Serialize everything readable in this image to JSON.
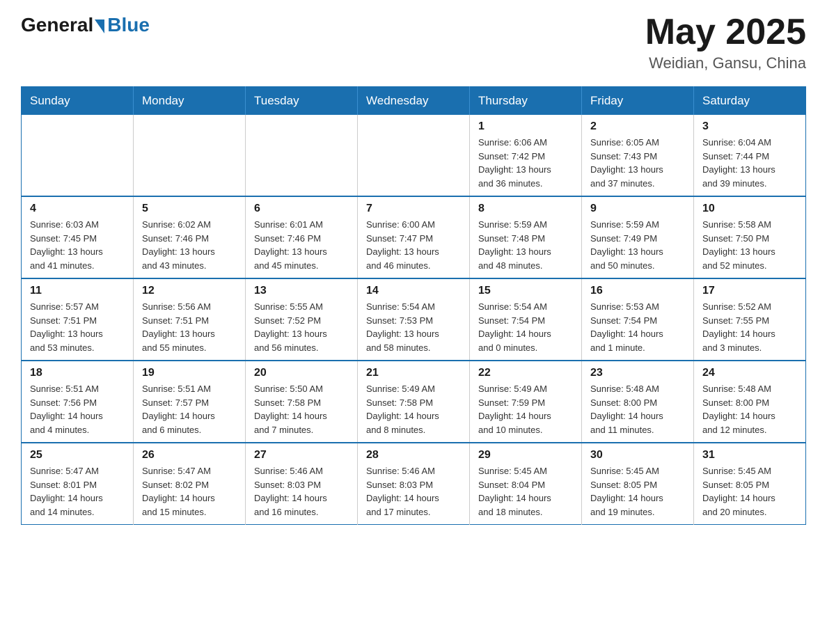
{
  "header": {
    "logo_general": "General",
    "logo_blue": "Blue",
    "title": "May 2025",
    "location": "Weidian, Gansu, China"
  },
  "days_of_week": [
    "Sunday",
    "Monday",
    "Tuesday",
    "Wednesday",
    "Thursday",
    "Friday",
    "Saturday"
  ],
  "weeks": [
    {
      "cells": [
        {
          "day": "",
          "info": ""
        },
        {
          "day": "",
          "info": ""
        },
        {
          "day": "",
          "info": ""
        },
        {
          "day": "",
          "info": ""
        },
        {
          "day": "1",
          "info": "Sunrise: 6:06 AM\nSunset: 7:42 PM\nDaylight: 13 hours\nand 36 minutes."
        },
        {
          "day": "2",
          "info": "Sunrise: 6:05 AM\nSunset: 7:43 PM\nDaylight: 13 hours\nand 37 minutes."
        },
        {
          "day": "3",
          "info": "Sunrise: 6:04 AM\nSunset: 7:44 PM\nDaylight: 13 hours\nand 39 minutes."
        }
      ]
    },
    {
      "cells": [
        {
          "day": "4",
          "info": "Sunrise: 6:03 AM\nSunset: 7:45 PM\nDaylight: 13 hours\nand 41 minutes."
        },
        {
          "day": "5",
          "info": "Sunrise: 6:02 AM\nSunset: 7:46 PM\nDaylight: 13 hours\nand 43 minutes."
        },
        {
          "day": "6",
          "info": "Sunrise: 6:01 AM\nSunset: 7:46 PM\nDaylight: 13 hours\nand 45 minutes."
        },
        {
          "day": "7",
          "info": "Sunrise: 6:00 AM\nSunset: 7:47 PM\nDaylight: 13 hours\nand 46 minutes."
        },
        {
          "day": "8",
          "info": "Sunrise: 5:59 AM\nSunset: 7:48 PM\nDaylight: 13 hours\nand 48 minutes."
        },
        {
          "day": "9",
          "info": "Sunrise: 5:59 AM\nSunset: 7:49 PM\nDaylight: 13 hours\nand 50 minutes."
        },
        {
          "day": "10",
          "info": "Sunrise: 5:58 AM\nSunset: 7:50 PM\nDaylight: 13 hours\nand 52 minutes."
        }
      ]
    },
    {
      "cells": [
        {
          "day": "11",
          "info": "Sunrise: 5:57 AM\nSunset: 7:51 PM\nDaylight: 13 hours\nand 53 minutes."
        },
        {
          "day": "12",
          "info": "Sunrise: 5:56 AM\nSunset: 7:51 PM\nDaylight: 13 hours\nand 55 minutes."
        },
        {
          "day": "13",
          "info": "Sunrise: 5:55 AM\nSunset: 7:52 PM\nDaylight: 13 hours\nand 56 minutes."
        },
        {
          "day": "14",
          "info": "Sunrise: 5:54 AM\nSunset: 7:53 PM\nDaylight: 13 hours\nand 58 minutes."
        },
        {
          "day": "15",
          "info": "Sunrise: 5:54 AM\nSunset: 7:54 PM\nDaylight: 14 hours\nand 0 minutes."
        },
        {
          "day": "16",
          "info": "Sunrise: 5:53 AM\nSunset: 7:54 PM\nDaylight: 14 hours\nand 1 minute."
        },
        {
          "day": "17",
          "info": "Sunrise: 5:52 AM\nSunset: 7:55 PM\nDaylight: 14 hours\nand 3 minutes."
        }
      ]
    },
    {
      "cells": [
        {
          "day": "18",
          "info": "Sunrise: 5:51 AM\nSunset: 7:56 PM\nDaylight: 14 hours\nand 4 minutes."
        },
        {
          "day": "19",
          "info": "Sunrise: 5:51 AM\nSunset: 7:57 PM\nDaylight: 14 hours\nand 6 minutes."
        },
        {
          "day": "20",
          "info": "Sunrise: 5:50 AM\nSunset: 7:58 PM\nDaylight: 14 hours\nand 7 minutes."
        },
        {
          "day": "21",
          "info": "Sunrise: 5:49 AM\nSunset: 7:58 PM\nDaylight: 14 hours\nand 8 minutes."
        },
        {
          "day": "22",
          "info": "Sunrise: 5:49 AM\nSunset: 7:59 PM\nDaylight: 14 hours\nand 10 minutes."
        },
        {
          "day": "23",
          "info": "Sunrise: 5:48 AM\nSunset: 8:00 PM\nDaylight: 14 hours\nand 11 minutes."
        },
        {
          "day": "24",
          "info": "Sunrise: 5:48 AM\nSunset: 8:00 PM\nDaylight: 14 hours\nand 12 minutes."
        }
      ]
    },
    {
      "cells": [
        {
          "day": "25",
          "info": "Sunrise: 5:47 AM\nSunset: 8:01 PM\nDaylight: 14 hours\nand 14 minutes."
        },
        {
          "day": "26",
          "info": "Sunrise: 5:47 AM\nSunset: 8:02 PM\nDaylight: 14 hours\nand 15 minutes."
        },
        {
          "day": "27",
          "info": "Sunrise: 5:46 AM\nSunset: 8:03 PM\nDaylight: 14 hours\nand 16 minutes."
        },
        {
          "day": "28",
          "info": "Sunrise: 5:46 AM\nSunset: 8:03 PM\nDaylight: 14 hours\nand 17 minutes."
        },
        {
          "day": "29",
          "info": "Sunrise: 5:45 AM\nSunset: 8:04 PM\nDaylight: 14 hours\nand 18 minutes."
        },
        {
          "day": "30",
          "info": "Sunrise: 5:45 AM\nSunset: 8:05 PM\nDaylight: 14 hours\nand 19 minutes."
        },
        {
          "day": "31",
          "info": "Sunrise: 5:45 AM\nSunset: 8:05 PM\nDaylight: 14 hours\nand 20 minutes."
        }
      ]
    }
  ]
}
